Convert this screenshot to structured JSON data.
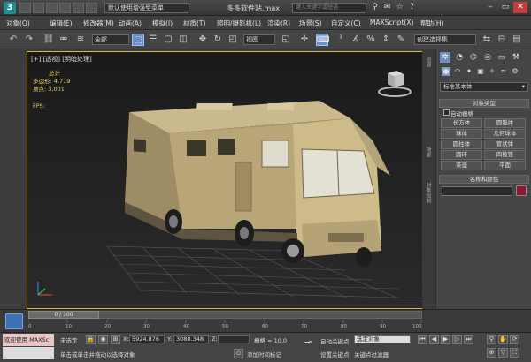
{
  "title_bar": {
    "app_logo": "3",
    "workspace": "默认使用增强型菜单",
    "file_title": "多多软件站.max",
    "search_placeholder": "键入关键字或短语"
  },
  "menu": [
    "对象(O)",
    "编辑(E)",
    "修改器(M)",
    "动画(A)",
    "模拟(I)",
    "材质(T)",
    "照明/摄影机(L)",
    "渲染(R)",
    "场景(S)",
    "自定义(C)",
    "MAXScript(X)",
    "帮助(H)"
  ],
  "toolbar": {
    "selection_filter": "全部",
    "reference_coord": "视图",
    "named_selection": "创建选择集"
  },
  "viewport": {
    "label": "[+] [透视] [明暗处理]",
    "stats": {
      "total_label": "总计",
      "polys_label": "多边形:",
      "polys_value": "4,719",
      "verts_label": "顶点:",
      "verts_value": "3,001"
    },
    "fps_label": "FPS:"
  },
  "command_panel": {
    "category": "标准基本体",
    "object_type_title": "对象类型",
    "autogrid_label": "自动栅格",
    "buttons": [
      "长方体",
      "圆锥体",
      "球体",
      "几何球体",
      "圆柱体",
      "管状体",
      "圆环",
      "四棱锥",
      "茶壶",
      "平面"
    ],
    "name_color_title": "名称和颜色",
    "side_labels": [
      "资源",
      "场景",
      "对象绘制"
    ]
  },
  "timeline": {
    "frame_display": "0 / 100",
    "ticks": [
      "0",
      "10",
      "20",
      "30",
      "40",
      "50",
      "60",
      "70",
      "80",
      "90",
      "100"
    ]
  },
  "status": {
    "listener": "欢迎使用 MAXSc",
    "selection_state": "未选定",
    "x_label": "X:",
    "x_value": "5924.876",
    "y_label": "Y:",
    "y_value": "3088.348",
    "z_label": "Z:",
    "grid": "栅格 = 10.0",
    "auto_key": "自动关键点",
    "set_key": "设置关键点",
    "selected_object": "选定对象",
    "key_filter": "关键点过滤器",
    "prompt": "单击或单击并拖动以选择对象",
    "add_time_tag": "添加时间标记"
  },
  "colors": {
    "viewport_border": "#d8b84a",
    "stats_text": "#e6d36a",
    "active_tool": "#6a90c8",
    "object_color": "#8c1630"
  }
}
